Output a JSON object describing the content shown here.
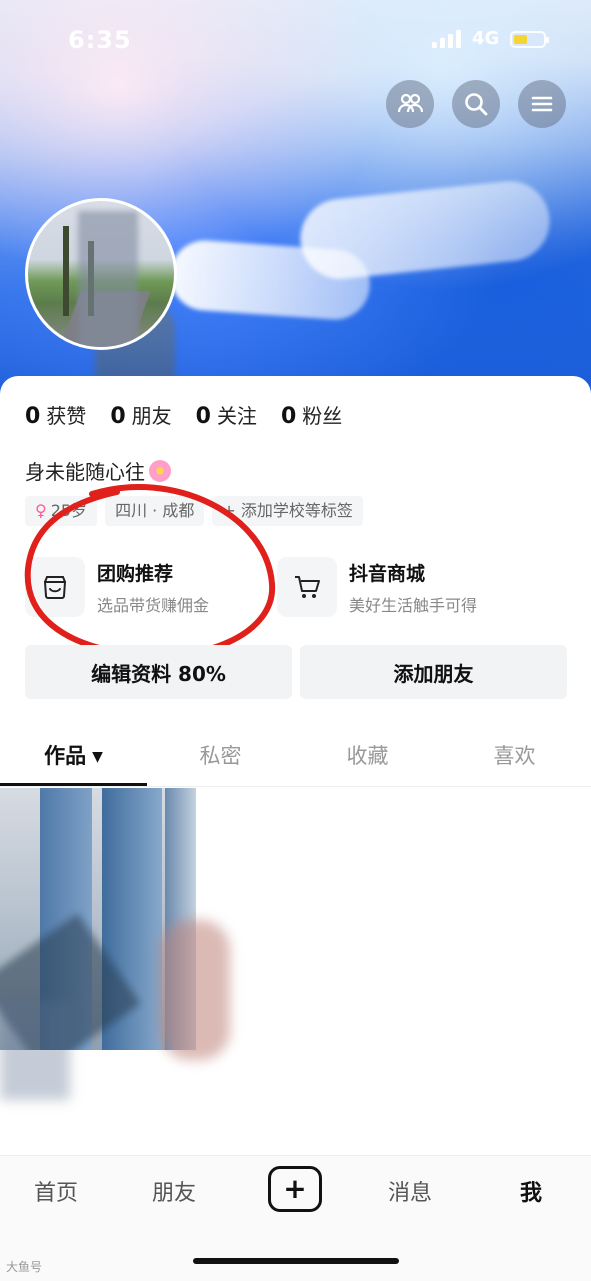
{
  "status_bar": {
    "time": "6:35",
    "network": "4G"
  },
  "profile": {
    "stats": [
      {
        "value": "0",
        "label": "获赞"
      },
      {
        "value": "0",
        "label": "朋友"
      },
      {
        "value": "0",
        "label": "关注"
      },
      {
        "value": "0",
        "label": "粉丝"
      }
    ],
    "bio": "身未能随心往",
    "tags": {
      "age": "25岁",
      "location": "四川 · 成都",
      "add_school": "+ 添加学校等标签"
    }
  },
  "shortcuts": [
    {
      "title": "团购推荐",
      "subtitle": "选品带货赚佣金",
      "icon": "store-icon"
    },
    {
      "title": "抖音商城",
      "subtitle": "美好生活触手可得",
      "icon": "cart-icon"
    }
  ],
  "actions": {
    "edit_profile": "编辑资料 80%",
    "add_friend": "添加朋友"
  },
  "tabs": [
    {
      "label": "作品",
      "active": true
    },
    {
      "label": "私密"
    },
    {
      "label": "收藏"
    },
    {
      "label": "喜欢"
    }
  ],
  "bottom_nav": {
    "home": "首页",
    "friends": "朋友",
    "plus": "+",
    "messages": "消息",
    "me": "我"
  },
  "watermark": "大鱼号"
}
